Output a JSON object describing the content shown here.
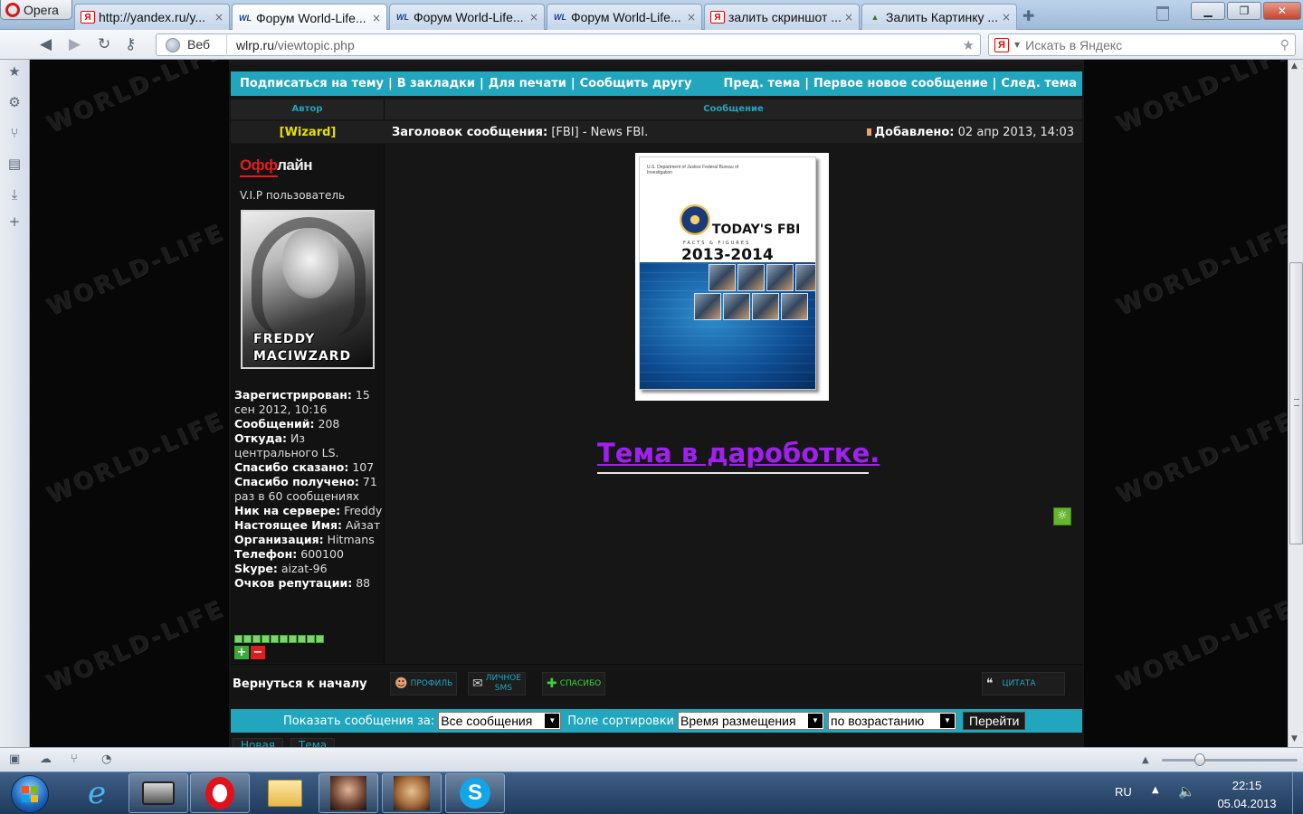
{
  "browser": {
    "opera_label": "Opera",
    "tabs": [
      {
        "favicon": "Я",
        "title": "http://yandex.ru/y...",
        "active": false
      },
      {
        "favicon": "WL",
        "title": "Форум World-Life...",
        "active": true
      },
      {
        "favicon": "WL",
        "title": "Форум World-Life...",
        "active": false
      },
      {
        "favicon": "WL",
        "title": "Форум World-Life...",
        "active": false
      },
      {
        "favicon": "Я",
        "title": "залить скриншот ...",
        "active": false
      },
      {
        "favicon": "▲",
        "title": "Залить Картинку ...",
        "active": false
      }
    ],
    "tab_close_glyph": "×",
    "address": {
      "web_label": "Веб",
      "host": "wlrp.ru",
      "path": "/viewtopic.php"
    },
    "search": {
      "engine_glyph": "Я",
      "placeholder": "Искать в Яндекс"
    },
    "window_buttons": {
      "minimize": "▁",
      "restore": "❐",
      "close": "✕"
    }
  },
  "forum": {
    "actions_left": [
      "Подписаться на тему",
      "В закладки",
      "Для печати",
      "Сообщить другу"
    ],
    "actions_right": [
      "Пред. тема",
      "Первое новое сообщение",
      "След. тема"
    ],
    "header_author": "Автор",
    "header_message": "Сообщение",
    "author_name": "[Wizard]",
    "subject_label": "Заголовок сообщения:",
    "subject_value": "[FBI] - News FBI.",
    "added_label": "Добавлено:",
    "added_value": "02 апр 2013, 14:03",
    "status_first": "Офф",
    "status_rest": "лайн",
    "rank": "V.I.P пользователь",
    "avatar_lines": [
      "FREDDY",
      "MACIWZARD"
    ],
    "stats": [
      {
        "key": "Зарегистрирован:",
        "value": "15 сен 2012, 10:16"
      },
      {
        "key": "Сообщений:",
        "value": "208"
      },
      {
        "key": "Откуда:",
        "value": "Из центрального LS."
      },
      {
        "key": "Спасибо сказано:",
        "value": "107"
      },
      {
        "key": "Спасибо получено:",
        "value": "71 раз в 60 сообщениях"
      },
      {
        "key": "Ник на сервере:",
        "value": "Freddy"
      },
      {
        "key": "Настоящее Имя:",
        "value": "Айзат"
      },
      {
        "key": "Организация:",
        "value": "Hitmans"
      },
      {
        "key": "Телефон:",
        "value": "600100"
      },
      {
        "key": "Skype:",
        "value": "aizat-96"
      },
      {
        "key": "Очков репутации:",
        "value": "88"
      }
    ],
    "reputation_blocks": 10,
    "rep_plus": "+",
    "rep_minus": "−",
    "cover": {
      "header": "U.S. Department of Justice Federal Bureau of Investigation",
      "title": "TODAY'S FBI",
      "subtitle": "FACTS & FIGURES",
      "years": "2013-2014"
    },
    "wip_text": "Тема в дароботке.",
    "back_to_top": "Вернуться к началу",
    "post_buttons": {
      "profile": "ПРОФИЛЬ",
      "sms_line1": "ЛИЧНОЕ",
      "sms_line2": "SMS",
      "thanks": "СПАСИБО",
      "quote": "ЦИТАТА"
    },
    "sort": {
      "show_label": "Показать сообщения за:",
      "show_value": "Все сообщения",
      "sort_label": "Поле сортировки",
      "sort_value": "Время размещения",
      "order_value": "по возрастанию",
      "go": "Перейти"
    },
    "bottom_buttons": [
      "Новая",
      "Тема"
    ],
    "watermark": "WORLD-LIFE"
  },
  "taskbar": {
    "lang": "RU",
    "time": "22:15",
    "date": "05.04.2013"
  }
}
